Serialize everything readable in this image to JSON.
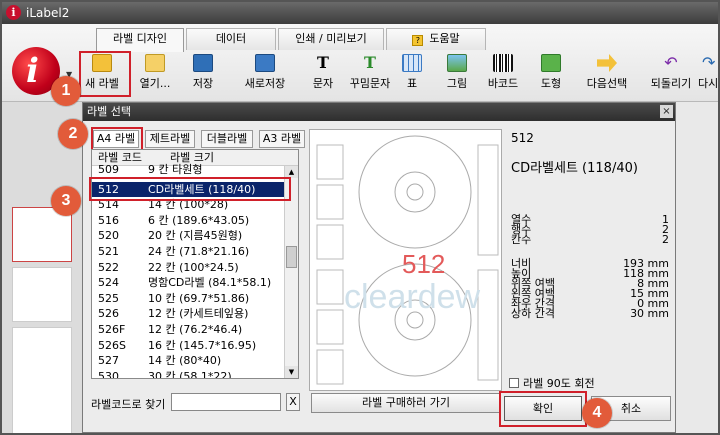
{
  "window": {
    "title": "iLabel2"
  },
  "ribbon": {
    "tabs": [
      {
        "label": "라벨 디자인",
        "active": true
      },
      {
        "label": "데이터",
        "active": false
      },
      {
        "label": "인쇄 / 미리보기",
        "active": false
      },
      {
        "label": "도움말",
        "active": false
      }
    ],
    "tools": [
      "새 라벨",
      "열기...",
      "저장",
      "새로저장",
      "문자",
      "꾸밈문자",
      "표",
      "그림",
      "바코드",
      "도형",
      "다음선택",
      "되돌리기",
      "다시하"
    ]
  },
  "dialog": {
    "title": "라벨 선택",
    "close_label": "×",
    "subtabs": [
      "A4 라벨",
      "제트라벨",
      "더블라벨",
      "A3 라벨"
    ],
    "list": {
      "headers": {
        "code": "라벨 코드",
        "size": "라벨 크기"
      },
      "rows": [
        {
          "code": "509",
          "size": "9 칸 타원형",
          "selected": false
        },
        {
          "code": "512",
          "size": "CD라벨세트 (118/40)",
          "selected": true
        },
        {
          "code": "514",
          "size": "14 칸 (100*28)",
          "selected": false
        },
        {
          "code": "516",
          "size": "6 칸 (189.6*43.05)",
          "selected": false
        },
        {
          "code": "520",
          "size": "20 칸 (지름45원형)",
          "selected": false
        },
        {
          "code": "521",
          "size": "24 칸 (71.8*21.16)",
          "selected": false
        },
        {
          "code": "522",
          "size": "22 칸 (100*24.5)",
          "selected": false
        },
        {
          "code": "524",
          "size": "명함CD라벨 (84.1*58.1)",
          "selected": false
        },
        {
          "code": "525",
          "size": "10 칸 (69.7*51.86)",
          "selected": false
        },
        {
          "code": "526",
          "size": "12 칸 (카세트테잎용)",
          "selected": false
        },
        {
          "code": "526F",
          "size": "12 칸 (76.2*46.4)",
          "selected": false
        },
        {
          "code": "526S",
          "size": "16 칸 (145.7*16.95)",
          "selected": false
        },
        {
          "code": "527",
          "size": "14 칸 (80*40)",
          "selected": false
        },
        {
          "code": "530",
          "size": "30 칸 (58.1*22)",
          "selected": false
        }
      ]
    },
    "find_label": "라벨코드로 찾기",
    "find_value": "",
    "find_clear": "X",
    "preview": {
      "code_watermark": "512",
      "brand_watermark": "cleardew"
    },
    "buy_button": "라벨 구매하러 가기",
    "info": {
      "code": "512",
      "name": "CD라벨세트 (118/40)",
      "counts": [
        {
          "label": "열수",
          "value": "1"
        },
        {
          "label": "행수",
          "value": "2"
        },
        {
          "label": "칸수",
          "value": "2"
        }
      ],
      "dims": [
        {
          "label": "너비",
          "value": "193 mm"
        },
        {
          "label": "높이",
          "value": "118 mm"
        },
        {
          "label": "위쪽 여백",
          "value": "8 mm"
        },
        {
          "label": "왼쪽 여백",
          "value": "15 mm"
        },
        {
          "label": "좌우 간격",
          "value": "0 mm"
        },
        {
          "label": "상하 간격",
          "value": "30 mm"
        }
      ]
    },
    "rotate_label": "라벨 90도 회전",
    "ok_button": "확인",
    "cancel_button": "취소"
  },
  "callouts": [
    "1",
    "2",
    "3",
    "4"
  ],
  "colors": {
    "accent_red": "#d0202a",
    "badge": "#e25b3a",
    "selection": "#0a246a"
  }
}
